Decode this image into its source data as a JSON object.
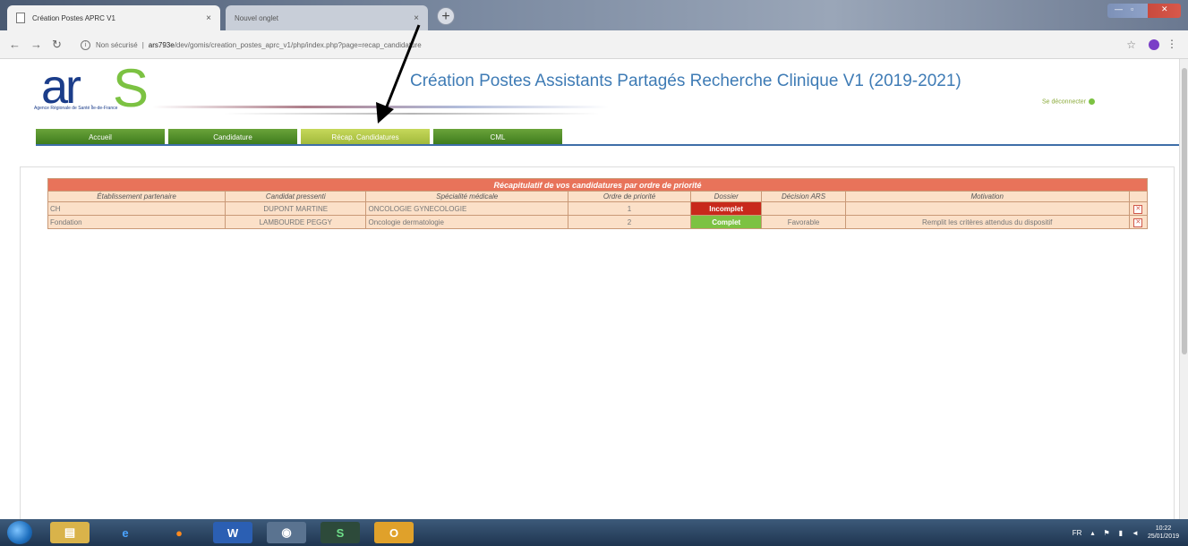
{
  "browser": {
    "tabs": [
      {
        "label": "Création Postes APRC V1",
        "close": "×"
      },
      {
        "label": "Nouvel onglet",
        "close": "×"
      }
    ],
    "new_tab": "+",
    "address": {
      "security": "Non sécurisé",
      "host": "ars793e",
      "path": "/dev/gomis/creation_postes_aprc_v1/php/index.php?page=recap_candidature"
    }
  },
  "site": {
    "logo_text": "ar",
    "logo_s": "S",
    "logo_sub": "Agence Régionale de Santé Île-de-France",
    "title": "Création Postes Assistants Partagés Recherche Clinique V1 (2019-2021)",
    "logout": "Se déconnecter"
  },
  "nav": [
    {
      "label": "Accueil",
      "active": false
    },
    {
      "label": "Candidature",
      "active": false
    },
    {
      "label": "Récap. Candidatures",
      "active": true
    },
    {
      "label": "CML",
      "active": false
    }
  ],
  "recap": {
    "caption": "Récapitulatif de vos candidatures par ordre de priorité",
    "headers": [
      "Établissement partenaire",
      "Candidat pressenti",
      "Spécialité médicale",
      "Ordre de priorité",
      "Dossier",
      "Décision ARS",
      "Motivation"
    ],
    "rows": [
      {
        "etablissement": "CH",
        "candidat": "DUPONT MARTINE",
        "specialite": "ONCOLOGIE GYNECOLOGIE",
        "ordre": "1",
        "dossier": "Incomplet",
        "dossier_color": "#c8291c",
        "decision": "",
        "motivation": ""
      },
      {
        "etablissement": "Fondation",
        "candidat": "LAMBOURDE PEGGY",
        "specialite": "Oncologie dermatologie",
        "ordre": "2",
        "dossier": "Complet",
        "dossier_color": "#7cc242",
        "decision": "Favorable",
        "motivation": "Remplit les critères attendus du dispositif"
      }
    ]
  },
  "taskbar": {
    "apps": [
      "start",
      "explorer",
      "ie",
      "firefox",
      "word",
      "chrome",
      "s-app",
      "outlook"
    ],
    "lang": "FR",
    "time": "10:22",
    "date": "25/01/2019"
  },
  "colors": {
    "nav_green": "#4c8a28",
    "nav_active": "#b5cc4a",
    "caption_bg": "#e8735a",
    "row_bg": "#fbe0c8",
    "title_blue": "#3e7bb5"
  }
}
